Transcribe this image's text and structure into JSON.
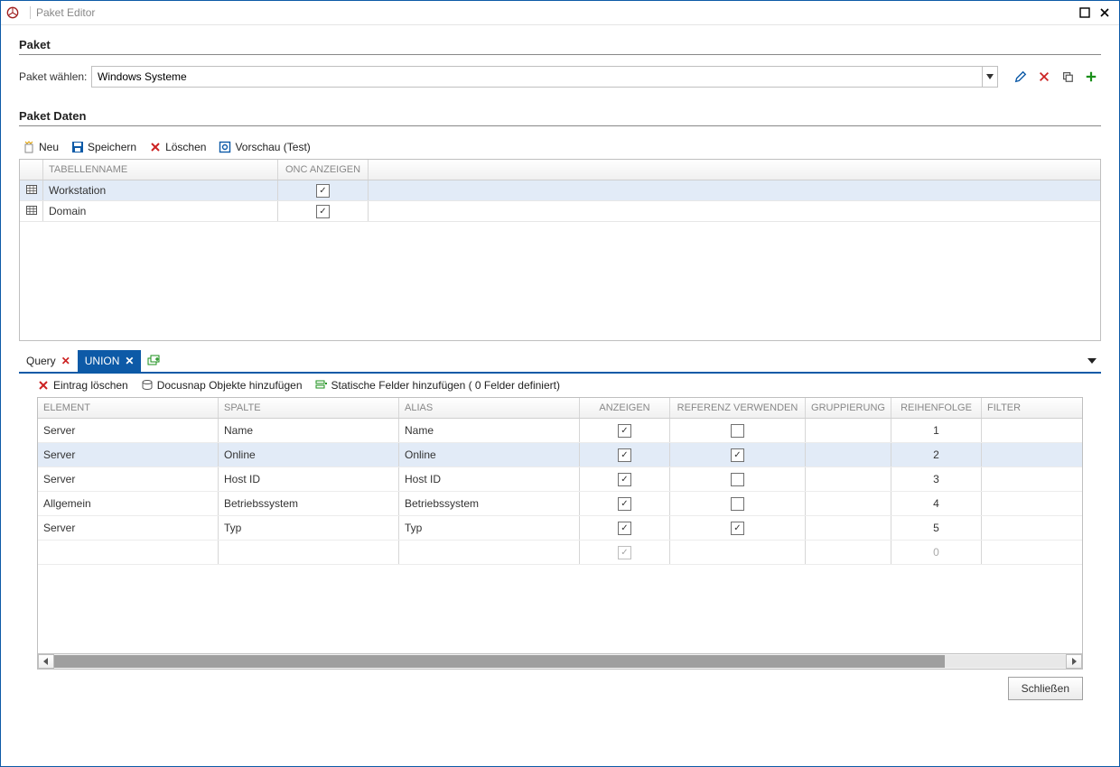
{
  "titlebar": {
    "title": "Paket Editor"
  },
  "section_paket": {
    "heading": "Paket",
    "select_label": "Paket wählen:",
    "selected_value": "Windows Systeme"
  },
  "section_daten": {
    "heading": "Paket Daten",
    "toolbar": {
      "neu": "Neu",
      "speichern": "Speichern",
      "loeschen": "Löschen",
      "vorschau": "Vorschau (Test)"
    },
    "grid": {
      "columns": {
        "tabellenname": "TABELLENNAME",
        "onc": "ONC ANZEIGEN"
      },
      "rows": [
        {
          "name": "Workstation",
          "onc": true,
          "selected": true
        },
        {
          "name": "Domain",
          "onc": true,
          "selected": false
        }
      ]
    }
  },
  "tabs": {
    "items": [
      {
        "label": "Query",
        "active": false
      },
      {
        "label": "UNION",
        "active": true
      }
    ]
  },
  "query_toolbar": {
    "eintrag_loeschen": "Eintrag löschen",
    "docusnap_add": "Docusnap Objekte hinzufügen",
    "statische_felder": "Statische Felder hinzufügen ( 0 Felder definiert)"
  },
  "query_grid": {
    "columns": {
      "element": "ELEMENT",
      "spalte": "SPALTE",
      "alias": "ALIAS",
      "anzeigen": "ANZEIGEN",
      "referenz": "REFERENZ VERWENDEN",
      "gruppierung": "GRUPPIERUNG",
      "reihenfolge": "REIHENFOLGE",
      "filter": "FILTER"
    },
    "rows": [
      {
        "element": "Server",
        "spalte": "Name",
        "alias": "Name",
        "anzeigen": true,
        "referenz": false,
        "reihenfolge": "1",
        "selected": false
      },
      {
        "element": "Server",
        "spalte": "Online",
        "alias": "Online",
        "anzeigen": true,
        "referenz": true,
        "reihenfolge": "2",
        "selected": true
      },
      {
        "element": "Server",
        "spalte": "Host ID",
        "alias": "Host ID",
        "anzeigen": true,
        "referenz": false,
        "reihenfolge": "3",
        "selected": false
      },
      {
        "element": "Allgemein",
        "spalte": "Betriebssystem",
        "alias": "Betriebssystem",
        "anzeigen": true,
        "referenz": false,
        "reihenfolge": "4",
        "selected": false
      },
      {
        "element": "Server",
        "spalte": "Typ",
        "alias": "Typ",
        "anzeigen": true,
        "referenz": true,
        "reihenfolge": "5",
        "selected": false
      }
    ],
    "placeholder": {
      "reihenfolge": "0"
    }
  },
  "footer": {
    "close": "Schließen"
  }
}
